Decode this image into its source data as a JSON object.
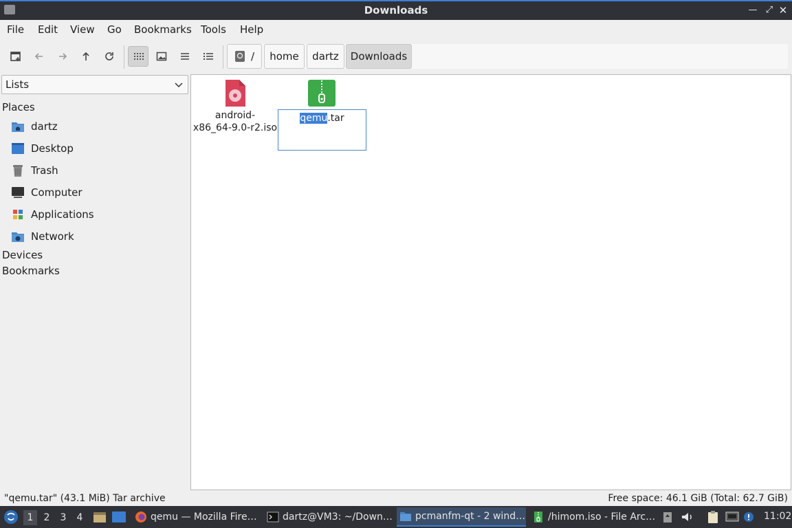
{
  "window": {
    "title": "Downloads"
  },
  "menu": [
    "File",
    "Edit",
    "View",
    "Go",
    "Bookmarks",
    "Tools",
    "Help"
  ],
  "path": {
    "root": "/",
    "crumbs": [
      "home",
      "dartz",
      "Downloads"
    ]
  },
  "sidebar": {
    "selector": "Lists",
    "places_label": "Places",
    "places": [
      {
        "label": "dartz",
        "icon": "home-folder-icon"
      },
      {
        "label": "Desktop",
        "icon": "desktop-icon"
      },
      {
        "label": "Trash",
        "icon": "trash-icon"
      },
      {
        "label": "Computer",
        "icon": "computer-icon"
      },
      {
        "label": "Applications",
        "icon": "applications-icon"
      },
      {
        "label": "Network",
        "icon": "network-icon"
      }
    ],
    "devices_label": "Devices",
    "bookmarks_label": "Bookmarks"
  },
  "files": [
    {
      "name_line1": "android-",
      "name_line2": "x86_64-9.0-r2.iso",
      "icon": "disc-image-icon"
    },
    {
      "name_selected": "qemu",
      "name_rest": ".tar",
      "icon": "archive-icon"
    }
  ],
  "status": {
    "left": "\"qemu.tar\" (43.1 MiB) Tar archive",
    "right": "Free space: 46.1 GiB (Total: 62.7 GiB)"
  },
  "taskbar": {
    "workspaces": [
      "1",
      "2",
      "3",
      "4"
    ],
    "tasks": [
      {
        "label": "qemu — Mozilla Fire…",
        "icon": "firefox-icon"
      },
      {
        "label": "dartz@VM3: ~/Down…",
        "icon": "terminal-icon"
      },
      {
        "label": "pcmanfm-qt - 2 wind…",
        "icon": "file-manager-icon"
      },
      {
        "label": "/himom.iso - File Arc…",
        "icon": "archive-manager-icon"
      }
    ],
    "clock": "11:02"
  },
  "colors": {
    "accent": "#3d7fd6",
    "archive_green": "#3daa4a",
    "iso_red": "#d9435a"
  }
}
